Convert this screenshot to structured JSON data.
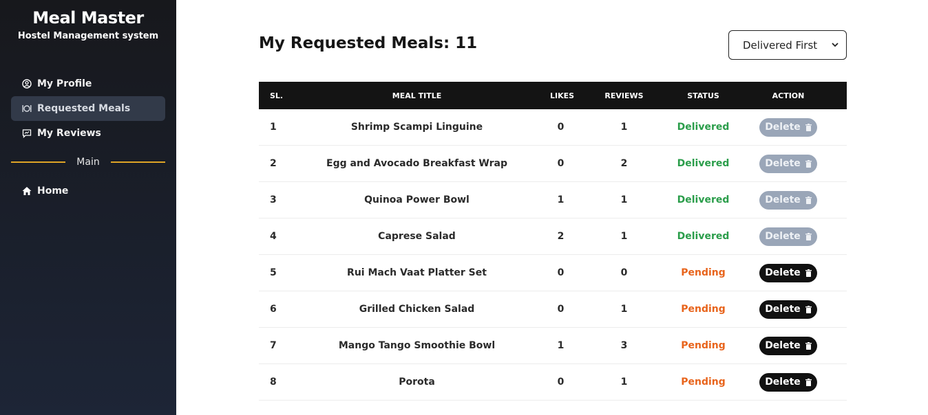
{
  "brand": {
    "title": "Meal Master",
    "subtitle": "Hostel Management system"
  },
  "sidebar": {
    "items": [
      {
        "label": "My Profile",
        "icon": "user-circle-icon"
      },
      {
        "label": "Requested Meals",
        "icon": "dinner-plate-icon"
      },
      {
        "label": "My Reviews",
        "icon": "review-icon"
      }
    ],
    "divider_label": "Main",
    "main_items": [
      {
        "label": "Home",
        "icon": "home-icon"
      }
    ]
  },
  "page": {
    "title": "My Requested Meals: 11"
  },
  "sort": {
    "selected": "Delivered First"
  },
  "table": {
    "headers": {
      "sl": "SL.",
      "title": "MEAL TITLE",
      "likes": "LIKES",
      "reviews": "REVIEWS",
      "status": "STATUS",
      "action": "ACTION"
    },
    "action_label": "Delete",
    "rows": [
      {
        "sl": "1",
        "title": "Shrimp Scampi Linguine",
        "likes": "0",
        "reviews": "1",
        "status": "Delivered"
      },
      {
        "sl": "2",
        "title": "Egg and Avocado Breakfast Wrap",
        "likes": "0",
        "reviews": "2",
        "status": "Delivered"
      },
      {
        "sl": "3",
        "title": "Quinoa Power Bowl",
        "likes": "1",
        "reviews": "1",
        "status": "Delivered"
      },
      {
        "sl": "4",
        "title": "Caprese Salad",
        "likes": "2",
        "reviews": "1",
        "status": "Delivered"
      },
      {
        "sl": "5",
        "title": "Rui Mach Vaat Platter Set",
        "likes": "0",
        "reviews": "0",
        "status": "Pending"
      },
      {
        "sl": "6",
        "title": "Grilled Chicken Salad",
        "likes": "0",
        "reviews": "1",
        "status": "Pending"
      },
      {
        "sl": "7",
        "title": "Mango Tango Smoothie Bowl",
        "likes": "1",
        "reviews": "3",
        "status": "Pending"
      },
      {
        "sl": "8",
        "title": "Porota",
        "likes": "0",
        "reviews": "1",
        "status": "Pending"
      }
    ]
  },
  "colors": {
    "delivered": "#2a9d4a",
    "pending": "#e8641c",
    "divider": "#e0a526",
    "disabled_button": "#9aa6b8"
  }
}
